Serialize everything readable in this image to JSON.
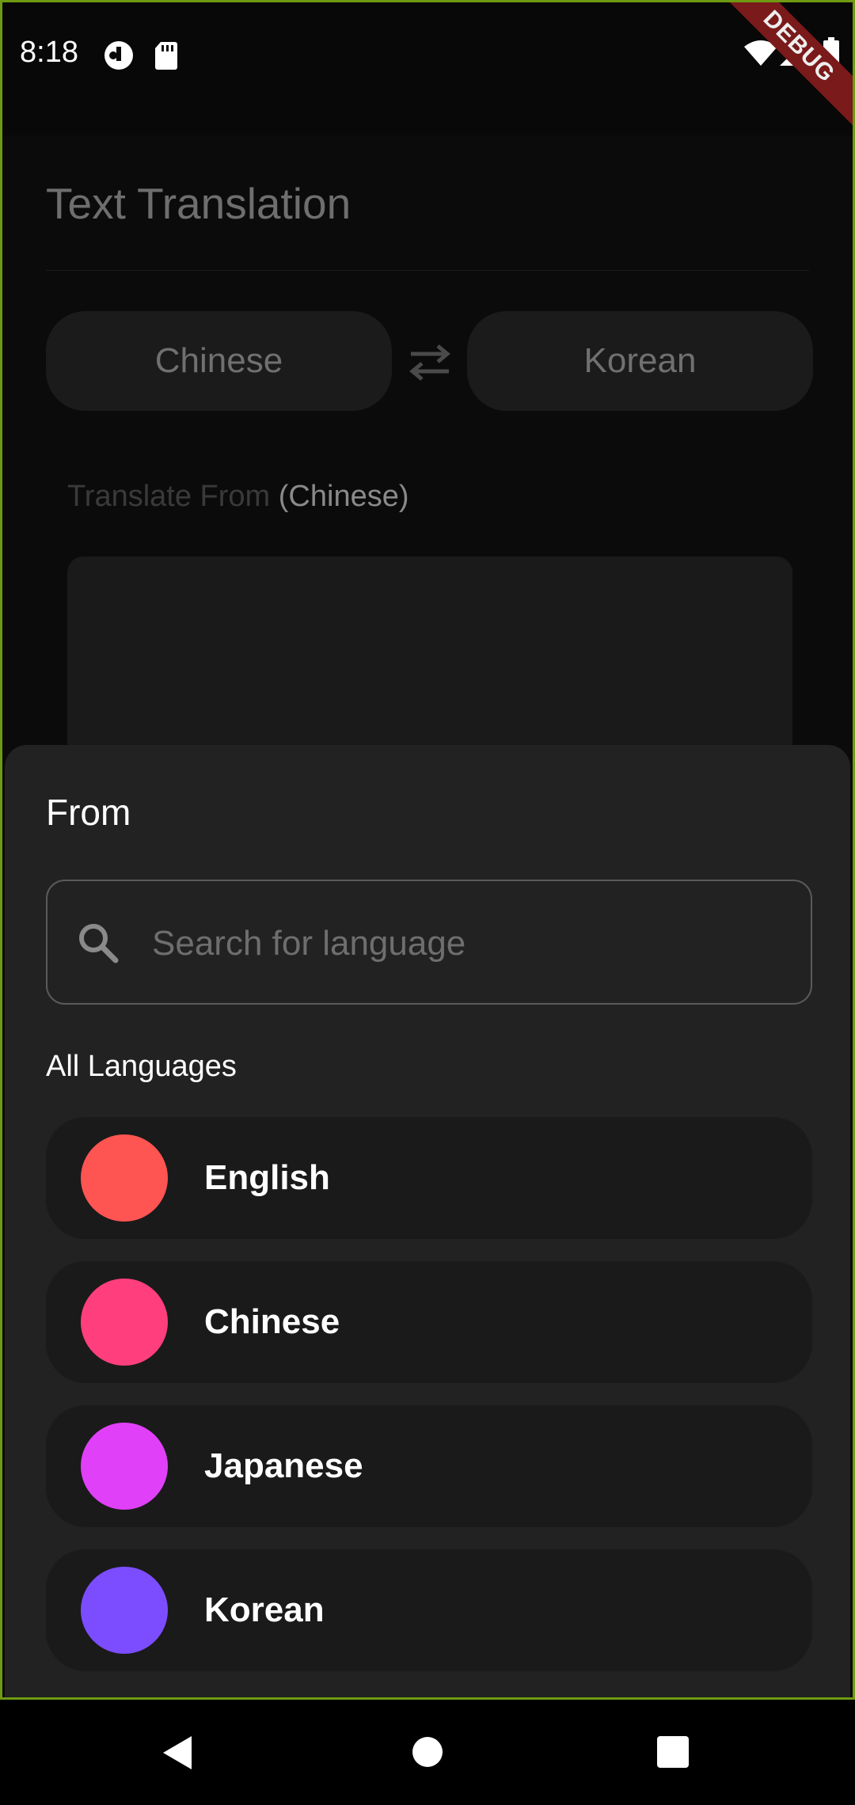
{
  "status_bar": {
    "time": "8:18",
    "debug_banner": "DEBUG"
  },
  "page": {
    "title": "Text Translation",
    "source_language": "Chinese",
    "target_language": "Korean",
    "translate_from_label": "Translate From",
    "translate_from_lang": "(Chinese)"
  },
  "sheet": {
    "title": "From",
    "search_placeholder": "Search for language",
    "section_label": "All Languages",
    "languages": [
      {
        "label": "English",
        "color": "#ff5552"
      },
      {
        "label": "Chinese",
        "color": "#ff3f7d"
      },
      {
        "label": "Japanese",
        "color": "#e040f8"
      },
      {
        "label": "Korean",
        "color": "#7c4dff"
      }
    ]
  },
  "colors": {
    "frame_border": "#6f9a12",
    "sheet_bg": "#222222",
    "item_bg": "#1a1a1a"
  },
  "icons": [
    "search-icon",
    "swap-icon",
    "wifi-icon",
    "signal-icon",
    "battery-icon",
    "back-icon",
    "home-icon",
    "recents-icon"
  ]
}
